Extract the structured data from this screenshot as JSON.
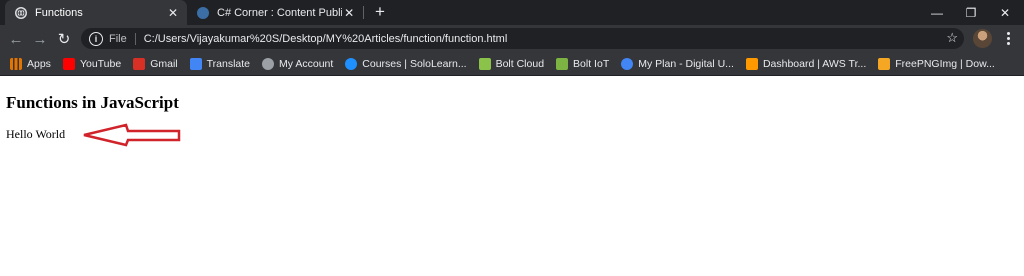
{
  "tabs": [
    {
      "title": "Functions",
      "active": true
    },
    {
      "title": "C# Corner : Content Publisher",
      "active": false
    }
  ],
  "window_controls": {
    "minimize": "—",
    "restore": "❐",
    "close": "✕"
  },
  "toolbar": {
    "back": "←",
    "forward": "→",
    "reload": "↻",
    "scheme_label": "File",
    "url": "C:/Users/Vijayakumar%20S/Desktop/MY%20Articles/function/function.html",
    "bookmark_star": "☆"
  },
  "bookmarks": [
    {
      "label": "Apps",
      "icon": "apps-grid-icon",
      "color": "#e37400"
    },
    {
      "label": "YouTube",
      "icon": "youtube-icon",
      "color": "#ff0000"
    },
    {
      "label": "Gmail",
      "icon": "gmail-icon",
      "color": "#d93025"
    },
    {
      "label": "Translate",
      "icon": "translate-icon",
      "color": "#4285f4"
    },
    {
      "label": "My Account",
      "icon": "google-account-icon",
      "color": "#9aa0a6"
    },
    {
      "label": "Courses | SoloLearn...",
      "icon": "sololearn-icon",
      "color": "#1e90ff"
    },
    {
      "label": "Bolt Cloud",
      "icon": "bolt-cloud-icon",
      "color": "#8bc34a"
    },
    {
      "label": "Bolt IoT",
      "icon": "bolt-iot-icon",
      "color": "#7cb342"
    },
    {
      "label": "My Plan - Digital U...",
      "icon": "google-icon",
      "color": "#4285f4"
    },
    {
      "label": "Dashboard | AWS Tr...",
      "icon": "aws-cube-icon",
      "color": "#ff9900"
    },
    {
      "label": "FreePNGImg | Dow...",
      "icon": "freepngimg-icon",
      "color": "#f5a623"
    }
  ],
  "page": {
    "heading": "Functions in JavaScript",
    "text": "Hello World",
    "arrow_color": "#d0232a"
  }
}
